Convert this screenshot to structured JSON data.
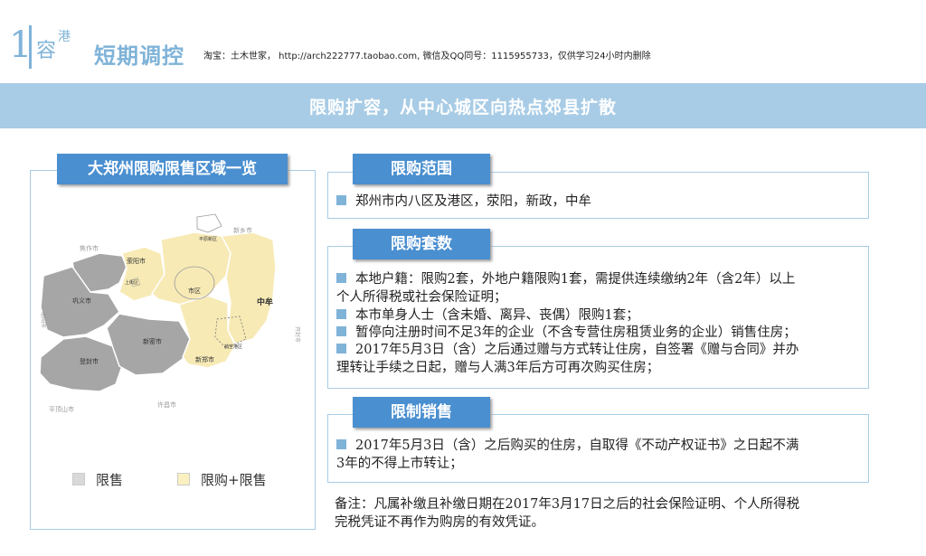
{
  "header": {
    "section_number": "1",
    "logo_text": "容",
    "logo_text_2": "港",
    "title": "短期调控",
    "source_note": "淘宝：土木世家， http://arch222777.taobao.com, 微信及QQ同号：1115955733，仅供学习24小时内删除"
  },
  "banner": {
    "title": "限购扩容，从中心城区向热点郊县扩散"
  },
  "map_panel": {
    "heading": "大郑州限购限售区域一览",
    "map_labels": {
      "xinxiang": "新乡市",
      "jiaozuo": "焦作市",
      "pingyuan": "平原新区",
      "xingyang": "荥阳市",
      "shangjie": "上街区",
      "gongyi": "巩义市",
      "shiqu": "市区",
      "zhongmou": "中牟",
      "luoyang": "洛阳市",
      "kaifeng": "开封市",
      "xinmi": "新密市",
      "hangkong": "航空港区",
      "xinzheng": "新郑市",
      "dengfeng": "登封市",
      "xuchang": "许昌市",
      "pingdingshan": "平顶山市"
    },
    "legend": [
      {
        "label": "限售",
        "color": "#d9d9d9"
      },
      {
        "label": "限购+限售",
        "color": "#fbf0c0"
      }
    ],
    "colors": {
      "restricted_sale": "#a6a6a6",
      "restricted_both": "#f7eab5",
      "accent": "#4a8fd0",
      "frame": "#a8cce6"
    }
  },
  "sections": [
    {
      "tag": "限购范围",
      "lines": [
        "郑州市内八区及港区，荥阳，新政，中牟"
      ]
    },
    {
      "tag": "限购套数",
      "lines": [
        "本地户籍：限购2套，外地户籍限购1套，需提供连续缴纳2年（含2年）以上",
        "个人所得税或社会保险证明；",
        "本市单身人士（含未婚、离异、丧偶）限购1套；",
        "暂停向注册时间不足3年的企业（不含专营住房租赁业务的企业）销售住房；",
        "2017年5月3日（含）之后通过赠与方式转让住房，自签署《赠与合同》并办",
        "理转让手续之日起，赠与人满3年后方可再次购买住房；"
      ]
    },
    {
      "tag": "限制销售",
      "lines": [
        "2017年5月3日（含）之后购买的住房，自取得《不动产权证书》之日起不满",
        "3年的不得上市转让；"
      ]
    }
  ],
  "footnote": {
    "line1": "备注：凡属补缴且补缴日期在2017年3月17日之后的社会保险证明、个人所得税",
    "line2": "完税凭证不再作为购房的有效凭证。"
  }
}
